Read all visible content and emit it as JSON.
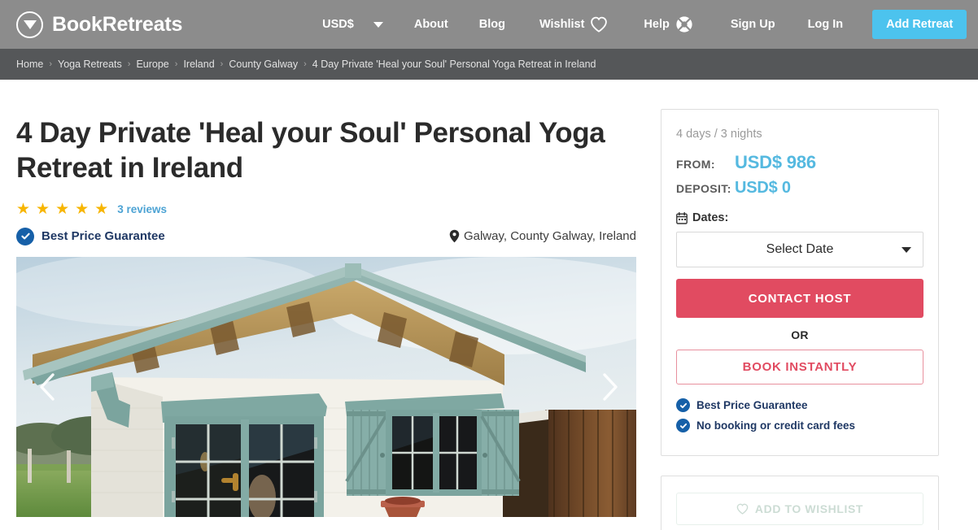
{
  "header": {
    "brand_name": "BookRetreats",
    "logo_icon": "triangle-in-circle-logo",
    "currency": "USD$",
    "currency_caret_icon": "chevron-down-icon",
    "nav": [
      {
        "label": "About",
        "icon": null
      },
      {
        "label": "Blog",
        "icon": null
      },
      {
        "label": "Wishlist",
        "icon": "heart-icon"
      },
      {
        "label": "Help",
        "icon": "lifebuoy-icon"
      },
      {
        "label": "Sign Up",
        "icon": null
      },
      {
        "label": "Log In",
        "icon": null
      }
    ],
    "add_retreat_label": "Add Retreat",
    "bg_color": "#8c8c8c",
    "accent_color": "#4cc3ee"
  },
  "breadcrumb": {
    "separator": "›",
    "items": [
      "Home",
      "Yoga Retreats",
      "Europe",
      "Ireland",
      "County Galway",
      "4 Day Private 'Heal your Soul' Personal Yoga Retreat in Ireland"
    ],
    "bg_color": "#555759"
  },
  "listing": {
    "title": "4 Day Private 'Heal your Soul' Personal Yoga Retreat in Ireland",
    "stars": 5,
    "star_glyph": "★",
    "star_color": "#f7b500",
    "reviews_label": "3 reviews",
    "best_price_guarantee": "Best Price Guarantee",
    "check_icon": "check-circle-icon",
    "location_icon": "map-pin-icon",
    "location": "Galway, County Galway, Ireland"
  },
  "gallery": {
    "prev_icon": "chevron-left-icon",
    "next_icon": "chevron-right-icon",
    "alt": "Teal green wooden cabin with white walls, French doors and shuttered window in a grassy field"
  },
  "booking": {
    "duration": "4 days / 3 nights",
    "from_label": "FROM:",
    "from_value": "USD$ 986",
    "deposit_label": "DEPOSIT:",
    "deposit_value": "USD$ 0",
    "price_color": "#55b9e0",
    "dates_label": "Dates:",
    "calendar_icon": "calendar-icon",
    "date_select_value": "Select Date",
    "date_caret_icon": "chevron-down-icon",
    "contact_host_label": "CONTACT HOST",
    "contact_host_color": "#e14b61",
    "or_label": "OR",
    "book_instantly_label": "BOOK INSTANTLY",
    "guarantees": [
      "Best Price Guarantee",
      "No booking or credit card fees"
    ]
  },
  "wishlist_card": {
    "button_label": "ADD TO WISHLIST",
    "heart_icon": "heart-icon"
  }
}
